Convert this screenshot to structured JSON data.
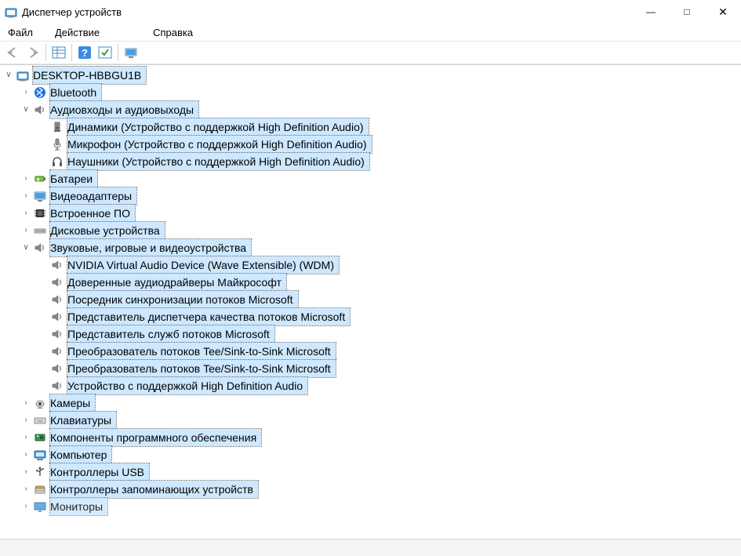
{
  "window": {
    "title": "Диспетчер устройств"
  },
  "menu": {
    "file": "Файл",
    "action": "Действие",
    "help": "Справка"
  },
  "tree": {
    "root": {
      "label": "DESKTOP-HBBGU1B"
    },
    "cats": {
      "bluetooth": "Bluetooth",
      "audio_io": "Аудиовходы и аудиовыходы",
      "batteries": "Батареи",
      "video_adapters": "Видеоадаптеры",
      "firmware": "Встроенное ПО",
      "disk_drives": "Дисковые устройства",
      "sound_game": "Звуковые, игровые и видеоустройства",
      "cameras": "Камеры",
      "keyboards": "Клавиатуры",
      "software_components": "Компоненты программного обеспечения",
      "computer": "Компьютер",
      "usb_controllers": "Контроллеры USB",
      "storage_controllers": "Контроллеры запоминающих устройств",
      "monitors": "Мониторы"
    },
    "audio_io_children": {
      "speakers": "Динамики (Устройство с поддержкой High Definition Audio)",
      "microphone": "Микрофон (Устройство с поддержкой High Definition Audio)",
      "headphones": "Наушники (Устройство с поддержкой High Definition Audio)"
    },
    "sound_children": {
      "nvidia": "NVIDIA Virtual Audio Device (Wave Extensible) (WDM)",
      "ms_trusted": "Доверенные аудиодрайверы Майкрософт",
      "sync_proxy": "Посредник синхронизации потоков Microsoft",
      "qos_rep": "Представитель диспетчера качества потоков Microsoft",
      "svc_rep": "Представитель служб потоков Microsoft",
      "tee1": "Преобразователь потоков Tee/Sink-to-Sink Microsoft",
      "tee2": "Преобразователь потоков Tee/Sink-to-Sink Microsoft",
      "hd_audio": "Устройство с поддержкой High Definition Audio"
    }
  }
}
